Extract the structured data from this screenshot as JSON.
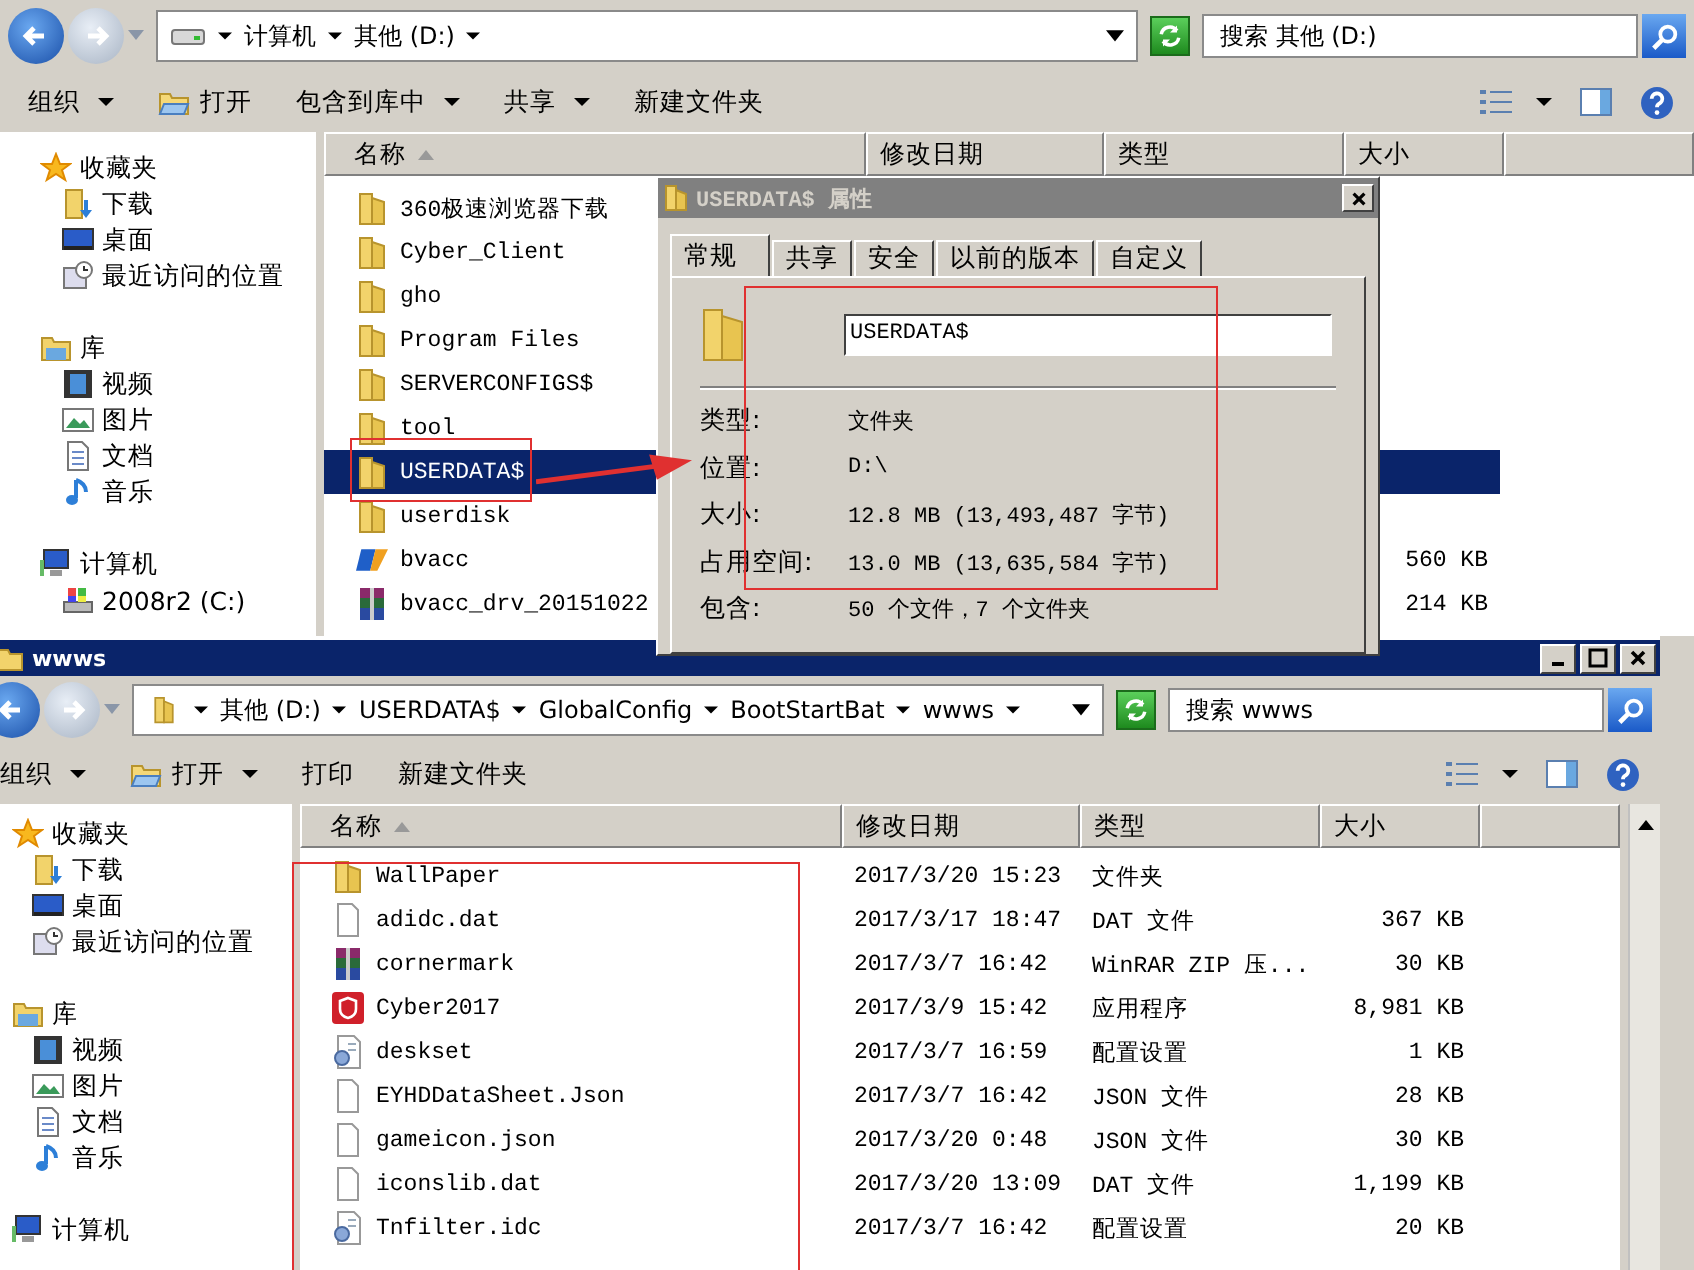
{
  "windows": [
    {
      "address": [
        "计算机",
        "其他 (D:)"
      ],
      "search": {
        "placeholder": "搜索 其他 (D:)"
      },
      "toolbar": [
        {
          "label": "组织",
          "dropdown": true
        },
        {
          "label": "打开",
          "dropdown": false,
          "kind": "open"
        },
        {
          "label": "包含到库中",
          "dropdown": true
        },
        {
          "label": "共享",
          "dropdown": true
        },
        {
          "label": "新建文件夹",
          "dropdown": false
        }
      ],
      "nav": [
        {
          "label": "收藏夹",
          "kind": "star",
          "children": [
            {
              "label": "下载",
              "kind": "download"
            },
            {
              "label": "桌面",
              "kind": "desktop"
            },
            {
              "label": "最近访问的位置",
              "kind": "recent"
            }
          ]
        },
        {
          "label": "库",
          "kind": "library",
          "children": [
            {
              "label": "视频",
              "kind": "video"
            },
            {
              "label": "图片",
              "kind": "picture"
            },
            {
              "label": "文档",
              "kind": "document"
            },
            {
              "label": "音乐",
              "kind": "music"
            }
          ]
        },
        {
          "label": "计算机",
          "kind": "computer",
          "children": [
            {
              "label": "2008r2 (C:)",
              "kind": "drive"
            }
          ]
        }
      ],
      "columns": [
        "名称",
        "修改日期",
        "类型",
        "大小"
      ],
      "files": [
        {
          "name": "360极速浏览器下载",
          "kind": "folder",
          "selected": false
        },
        {
          "name": "Cyber_Client",
          "kind": "folder",
          "selected": false
        },
        {
          "name": "gho",
          "kind": "folder",
          "selected": false
        },
        {
          "name": "Program Files",
          "kind": "folder",
          "selected": false
        },
        {
          "name": "SERVERCONFIGS$",
          "kind": "folder",
          "selected": false
        },
        {
          "name": "tool",
          "kind": "folder",
          "selected": false
        },
        {
          "name": "USERDATA$",
          "kind": "folder",
          "selected": true
        },
        {
          "name": "userdisk",
          "kind": "folder",
          "selected": false
        },
        {
          "name": "bvacc",
          "kind": "bv",
          "size": "560 KB",
          "selected": false
        },
        {
          "name": "bvacc_drv_20151022",
          "kind": "archive",
          "size": "214 KB",
          "selected": false
        }
      ]
    },
    {
      "title": "wwws",
      "address": [
        "其他 (D:)",
        "USERDATA$",
        "GlobalConfig",
        "BootStartBat",
        "wwws"
      ],
      "search": {
        "placeholder": "搜索 wwws"
      },
      "toolbar": [
        {
          "label": "组织",
          "dropdown": true
        },
        {
          "label": "打开",
          "dropdown": true,
          "kind": "open"
        },
        {
          "label": "打印",
          "dropdown": false
        },
        {
          "label": "新建文件夹",
          "dropdown": false
        }
      ],
      "nav": [
        {
          "label": "收藏夹",
          "kind": "star",
          "children": [
            {
              "label": "下载",
              "kind": "download"
            },
            {
              "label": "桌面",
              "kind": "desktop"
            },
            {
              "label": "最近访问的位置",
              "kind": "recent"
            }
          ]
        },
        {
          "label": "库",
          "kind": "library",
          "children": [
            {
              "label": "视频",
              "kind": "video"
            },
            {
              "label": "图片",
              "kind": "picture"
            },
            {
              "label": "文档",
              "kind": "document"
            },
            {
              "label": "音乐",
              "kind": "music"
            }
          ]
        },
        {
          "label": "计算机",
          "kind": "computer"
        }
      ],
      "columns": [
        "名称",
        "修改日期",
        "类型",
        "大小"
      ],
      "files": [
        {
          "name": "WallPaper",
          "kind": "folder",
          "date": "2017/3/20 15:23",
          "type": "文件夹",
          "selected": false
        },
        {
          "name": "adidc.dat",
          "kind": "file",
          "date": "2017/3/17 18:47",
          "type": "DAT 文件",
          "size": "367 KB",
          "selected": false
        },
        {
          "name": "cornermark",
          "kind": "archive",
          "date": "2017/3/7 16:42",
          "type": "WinRAR ZIP 压...",
          "size": "30 KB",
          "selected": false
        },
        {
          "name": "Cyber2017",
          "kind": "app",
          "date": "2017/3/9 15:42",
          "type": "应用程序",
          "size": "8,981 KB",
          "selected": false
        },
        {
          "name": "deskset",
          "kind": "config",
          "date": "2017/3/7 16:59",
          "type": "配置设置",
          "size": "1 KB",
          "selected": false
        },
        {
          "name": "EYHDDataSheet.Json",
          "kind": "file",
          "date": "2017/3/7 16:42",
          "type": "JSON 文件",
          "size": "28 KB",
          "selected": false
        },
        {
          "name": "gameicon.json",
          "kind": "file",
          "date": "2017/3/20 0:48",
          "type": "JSON 文件",
          "size": "30 KB",
          "selected": false
        },
        {
          "name": "iconslib.dat",
          "kind": "file",
          "date": "2017/3/20 13:09",
          "type": "DAT 文件",
          "size": "1,199 KB",
          "selected": false
        },
        {
          "name": "Tnfilter.idc",
          "kind": "config",
          "date": "2017/3/7 16:42",
          "type": "配置设置",
          "size": "20 KB",
          "selected": false
        }
      ]
    }
  ],
  "properties": {
    "title": "USERDATA$ 属性",
    "tabs": [
      {
        "label": "常规",
        "selected": true
      },
      {
        "label": "共享",
        "selected": false
      },
      {
        "label": "安全",
        "selected": false
      },
      {
        "label": "以前的版本",
        "selected": false
      },
      {
        "label": "自定义",
        "selected": false
      }
    ],
    "name": "USERDATA$",
    "rows": [
      {
        "label": "类型:",
        "value": "文件夹"
      },
      {
        "label": "位置:",
        "value": "D:\\"
      },
      {
        "label": "大小:",
        "value": "12.8 MB (13,493,487 字节)"
      },
      {
        "label": "占用空间:",
        "value": "13.0 MB (13,635,584 字节)"
      },
      {
        "label": "包含:",
        "value": "50 个文件，7 个文件夹"
      }
    ]
  }
}
